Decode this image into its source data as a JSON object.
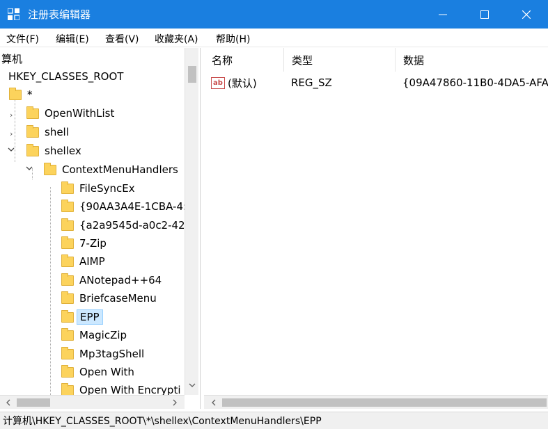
{
  "window": {
    "title": "注册表编辑器",
    "controls": {
      "minimize": "minimize-icon",
      "maximize": "maximize-icon",
      "close": "close-icon"
    }
  },
  "menu": [
    "文件(F)",
    "编辑(E)",
    "查看(V)",
    "收藏夹(A)",
    "帮助(H)"
  ],
  "tree": {
    "root_partial": "算机",
    "hkey": "HKEY_CLASSES_ROOT",
    "star": "*",
    "nodes": [
      "OpenWithList",
      "shell",
      "shellex",
      "ContextMenuHandlers"
    ],
    "handlers": [
      "FileSyncEx",
      "{90AA3A4E-1CBA-4:",
      "{a2a9545d-a0c2-42",
      "7-Zip",
      "AIMP",
      "ANotepad++64",
      "BriefcaseMenu",
      "EPP",
      "MagicZip",
      "Mp3tagShell",
      "Open With",
      "Open With Encrypti"
    ],
    "selected": "EPP"
  },
  "list": {
    "columns": [
      "名称",
      "类型",
      "数据"
    ],
    "rows": [
      {
        "name": "(默认)",
        "type": "REG_SZ",
        "data": "{09A47860-11B0-4DA5-AFA"
      }
    ]
  },
  "status": "计算机\\HKEY_CLASSES_ROOT\\*\\shellex\\ContextMenuHandlers\\EPP",
  "colors": {
    "titlebar": "#1a7fe0",
    "folder": "#fcd35c",
    "selection": "#cce8ff"
  }
}
